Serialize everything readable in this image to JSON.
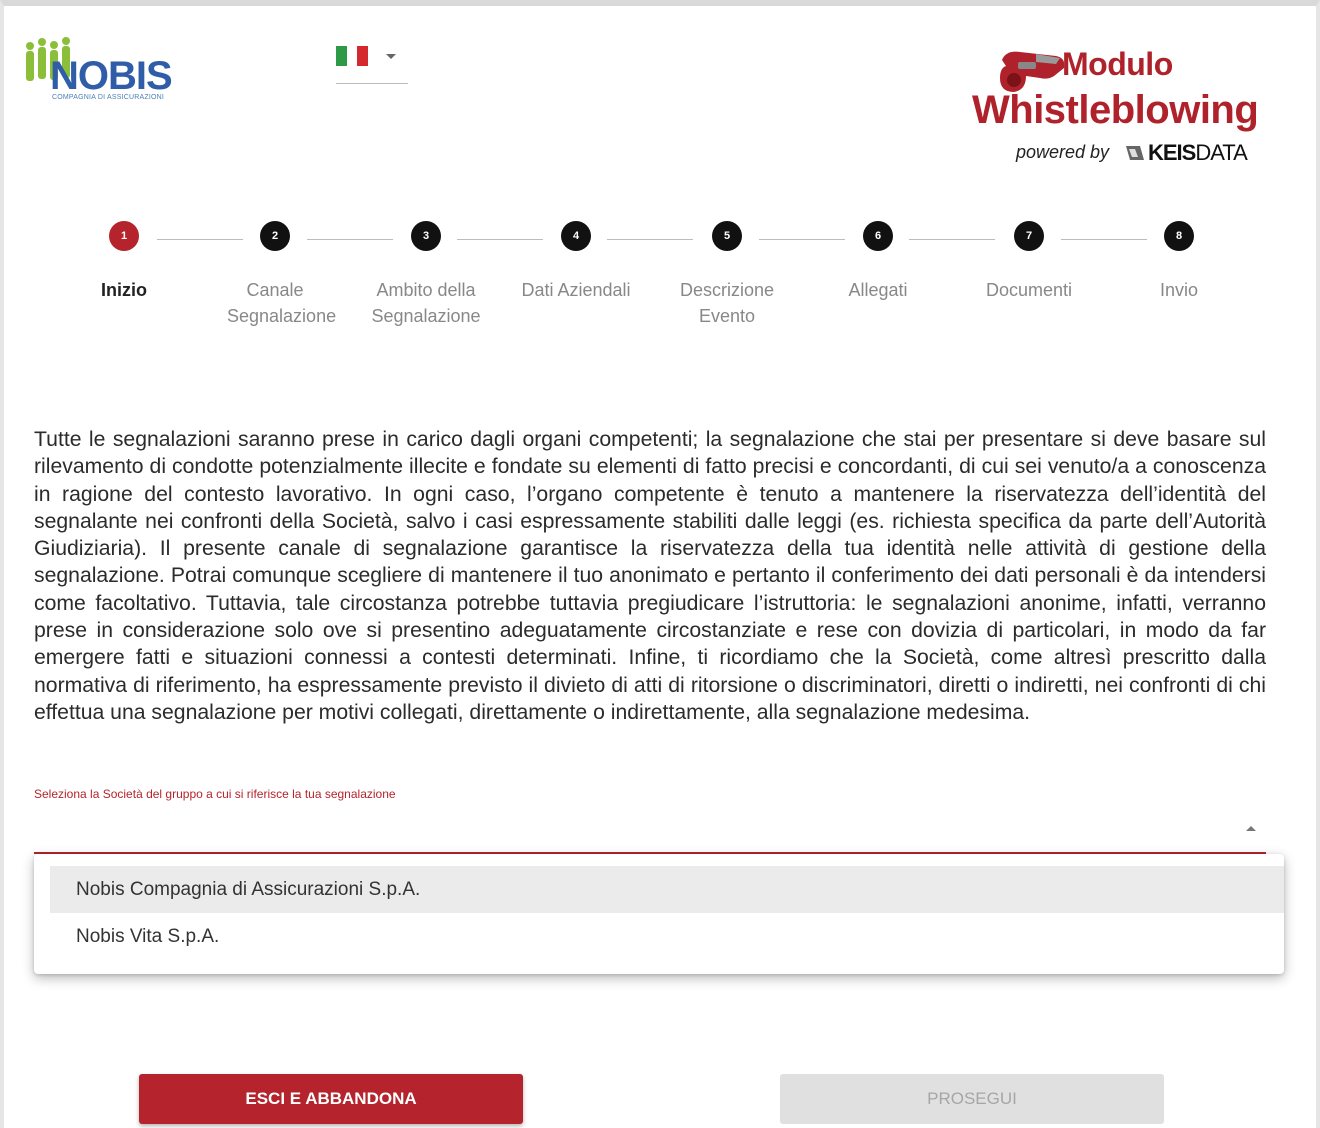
{
  "header": {
    "nobis_logo": {
      "word": "NOBIS",
      "sub": "COMPAGNIA DI ASSICURAZIONI"
    },
    "language": {
      "flag": "italy-flag-icon",
      "colors": [
        "#2e9a46",
        "#ffffff",
        "#d42a2f"
      ]
    },
    "brand": {
      "line1": "Modulo",
      "line2": "Whistleblowing",
      "powered_by": "powered by",
      "keis_bold": "KEIS",
      "keis_light": "DATA",
      "accent": "#b0222b"
    }
  },
  "stepper": {
    "steps": [
      {
        "num": "1",
        "label": "Inizio",
        "active": true
      },
      {
        "num": "2",
        "label": "Canale Segnalazione"
      },
      {
        "num": "3",
        "label": "Ambito della Segnalazione"
      },
      {
        "num": "4",
        "label": "Dati Aziendali"
      },
      {
        "num": "5",
        "label": "Descrizione Evento"
      },
      {
        "num": "6",
        "label": "Allegati"
      },
      {
        "num": "7",
        "label": "Documenti"
      },
      {
        "num": "8",
        "label": "Invio"
      }
    ],
    "active_color": "#b5242c"
  },
  "main": {
    "intro": "Tutte le segnalazioni saranno prese in carico dagli organi competenti; la segnalazione che stai per presentare si deve basare sul rilevamento di condotte potenzialmente illecite e fondate su elementi di fatto precisi e concordanti, di cui sei venuto/a a conoscenza in ragione del contesto lavorativo. In ogni caso, l’organo competente è tenuto a mantenere la riservatezza dell’identità del segnalante nei confronti della Società, salvo i casi espressamente stabiliti dalle leggi (es. richiesta specifica da parte dell’Autorità Giudiziaria). Il presente canale di segnalazione garantisce la riservatezza della tua identità nelle attività di gestione della segnalazione. Potrai comunque scegliere di mantenere il tuo anonimato e pertanto il conferimento dei dati personali è da intendersi come facoltativo. Tuttavia, tale circostanza potrebbe tuttavia pregiudicare l’istruttoria: le segnalazioni anonime, infatti, verranno prese in considerazione solo ove si presentino adeguatamente circostanziate e rese con dovizia di particolari, in modo da far emergere fatti e situazioni connessi a contesti determinati. Infine, ti ricordiamo che la Società, come altresì prescritto dalla normativa di riferimento, ha espressamente previsto il divieto di atti di ritorsione o discriminatori, diretti o indiretti, nei confronti di chi effettua una segnalazione per motivi collegati, direttamente o indirettamente, alla segnalazione medesima.",
    "company_select": {
      "label": "Seleziona la Società del gruppo a cui si riferisce la tua segnalazione",
      "value": "",
      "options": [
        "Nobis Compagnia di Assicurazioni S.p.A.",
        "Nobis Vita S.p.A."
      ]
    }
  },
  "buttons": {
    "exit": "ESCI E ABBANDONA",
    "next": "PROSEGUI"
  }
}
